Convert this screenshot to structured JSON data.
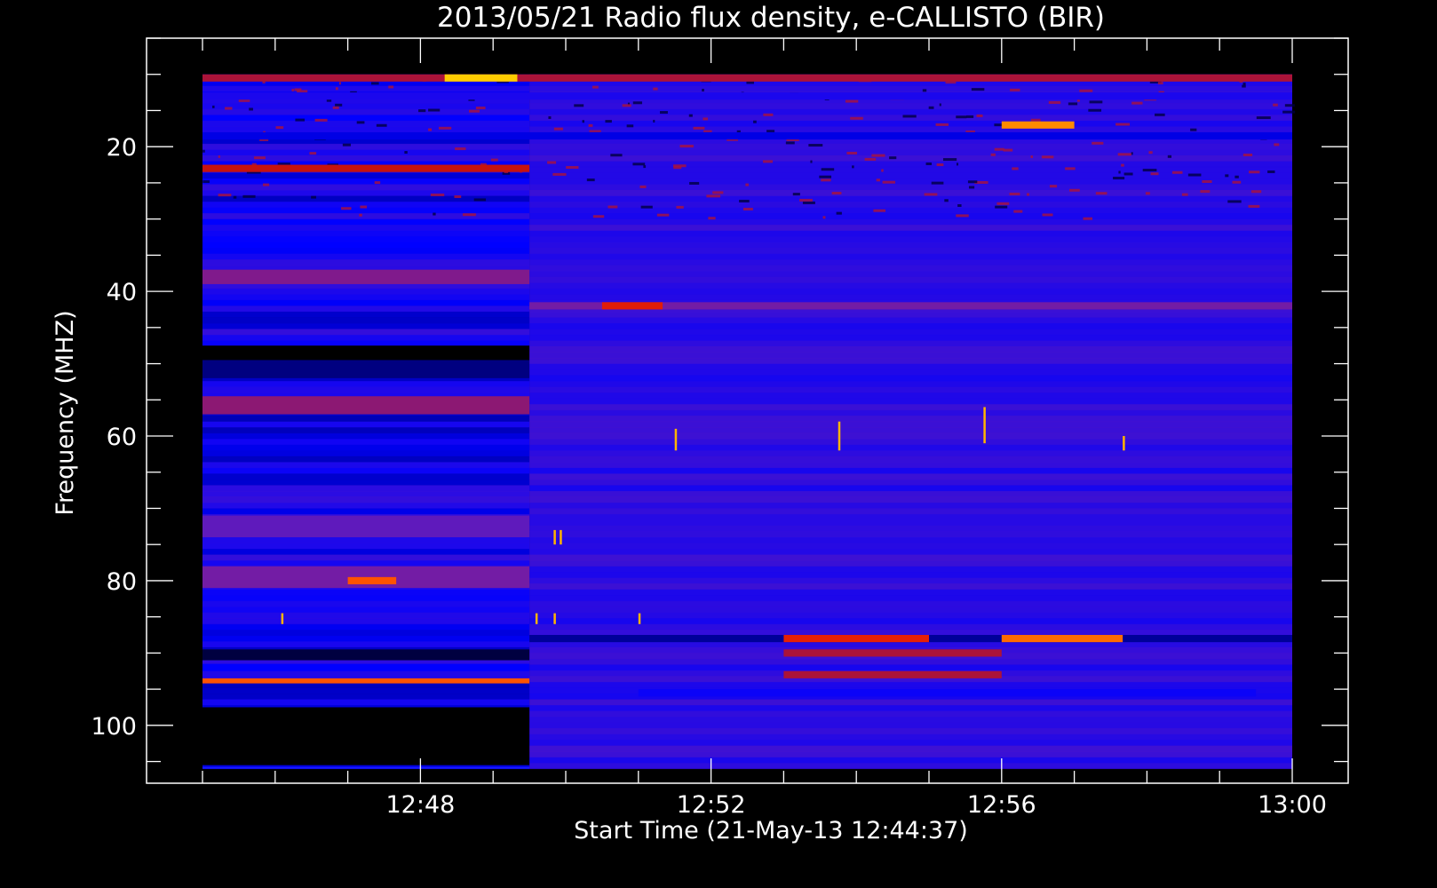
{
  "chart_data": {
    "type": "heatmap",
    "title": "2013/05/21  Radio flux density, e-CALLISTO (BIR)",
    "xlabel": "Start Time (21-May-13 12:44:37)",
    "ylabel": "Frequency (MHZ)",
    "x_axis": {
      "unit": "time (HH:MM)",
      "range": [
        "12:44:37",
        "13:00"
      ],
      "plot_range": [
        "12:45",
        "13:00"
      ],
      "major_ticks": [
        "12:48",
        "12:52",
        "12:56",
        "13:00"
      ],
      "minor_tick_step_min": 1
    },
    "y_axis": {
      "unit": "MHz",
      "inverted": true,
      "range": [
        10,
        106
      ],
      "plot_range": [
        5,
        108
      ],
      "major_ticks": [
        20,
        40,
        60,
        80,
        100
      ],
      "minor_tick_step": 5
    },
    "colormap": [
      "#000000",
      "#0000ff",
      "#6a1db5",
      "#c01010",
      "#ff2a00",
      "#ffcc00"
    ],
    "background_color": "#000000",
    "foreground_color": "#ffffff",
    "grid": false,
    "regime_change_time": "12:49:30",
    "features": [
      {
        "kind": "band",
        "t": [
          "12:45",
          "12:49:30"
        ],
        "f": [
          47.5,
          49.5
        ],
        "level": 0.0
      },
      {
        "kind": "band",
        "t": [
          "12:45",
          "12:49:30"
        ],
        "f": [
          49.5,
          52
        ],
        "level": 0.1
      },
      {
        "kind": "band",
        "t": [
          "12:45",
          "12:49:30"
        ],
        "f": [
          54.5,
          57
        ],
        "level": 0.48
      },
      {
        "kind": "band",
        "t": [
          "12:45",
          "12:49:30"
        ],
        "f": [
          37,
          39
        ],
        "level": 0.45
      },
      {
        "kind": "band",
        "t": [
          "12:45",
          "12:49:30"
        ],
        "f": [
          22.5,
          23.5
        ],
        "level": 0.62
      },
      {
        "kind": "band",
        "t": [
          "12:45",
          "12:49:30"
        ],
        "f": [
          71,
          74
        ],
        "level": 0.38
      },
      {
        "kind": "band",
        "t": [
          "12:45",
          "12:49:30"
        ],
        "f": [
          78,
          81
        ],
        "level": 0.42
      },
      {
        "kind": "band",
        "t": [
          "12:47",
          "12:47:40"
        ],
        "f": [
          79.5,
          80.5
        ],
        "level": 0.85
      },
      {
        "kind": "band",
        "t": [
          "12:45",
          "12:49:30"
        ],
        "f": [
          89.5,
          91
        ],
        "level": 0.05
      },
      {
        "kind": "band",
        "t": [
          "12:45",
          "12:49:30"
        ],
        "f": [
          93.5,
          94.2
        ],
        "level": 0.85
      },
      {
        "kind": "band",
        "t": [
          "12:45",
          "12:49:30"
        ],
        "f": [
          91.5,
          92.5
        ],
        "level": 0.2
      },
      {
        "kind": "band",
        "t": [
          "12:45",
          "12:49:30"
        ],
        "f": [
          97.5,
          105.5
        ],
        "level": 0.0
      },
      {
        "kind": "band",
        "t": [
          "12:45",
          "13:00"
        ],
        "f": [
          10,
          11
        ],
        "level": 0.55
      },
      {
        "kind": "band",
        "t": [
          "12:48:20",
          "12:49:20"
        ],
        "f": [
          10,
          11
        ],
        "level": 1.0
      },
      {
        "kind": "band",
        "t": [
          "12:45",
          "13:00"
        ],
        "f": [
          12.5,
          13.5
        ],
        "level": 0.25
      },
      {
        "kind": "band",
        "t": [
          "12:45",
          "13:00"
        ],
        "f": [
          18,
          19
        ],
        "level": 0.18
      },
      {
        "kind": "band",
        "t": [
          "12:56",
          "12:57"
        ],
        "f": [
          16.5,
          17.5
        ],
        "level": 0.92
      },
      {
        "kind": "band",
        "t": [
          "12:49:30",
          "13:00"
        ],
        "f": [
          41.5,
          42.5
        ],
        "level": 0.42
      },
      {
        "kind": "band",
        "t": [
          "12:50:30",
          "12:51:20"
        ],
        "f": [
          41.5,
          42.5
        ],
        "level": 0.7
      },
      {
        "kind": "band",
        "t": [
          "12:49:30",
          "13:00"
        ],
        "f": [
          87.5,
          88.5
        ],
        "level": 0.12
      },
      {
        "kind": "band",
        "t": [
          "12:53",
          "12:55"
        ],
        "f": [
          87.5,
          88.5
        ],
        "level": 0.72
      },
      {
        "kind": "band",
        "t": [
          "12:56",
          "12:57:40"
        ],
        "f": [
          87.5,
          88.5
        ],
        "level": 0.88
      },
      {
        "kind": "band",
        "t": [
          "12:53",
          "12:56"
        ],
        "f": [
          89.5,
          90.5
        ],
        "level": 0.55
      },
      {
        "kind": "band",
        "t": [
          "12:51:00",
          "12:59:30"
        ],
        "f": [
          95,
          96
        ],
        "level": 0.22
      },
      {
        "kind": "band",
        "t": [
          "12:53",
          "12:56"
        ],
        "f": [
          92.5,
          93.5
        ],
        "level": 0.55
      }
    ],
    "spikes": [
      {
        "t": "12:49:50",
        "f": [
          73,
          75
        ]
      },
      {
        "t": "12:49:55",
        "f": [
          73,
          75
        ]
      },
      {
        "t": "12:49:35",
        "f": [
          84.5,
          86
        ]
      },
      {
        "t": "12:49:50",
        "f": [
          84.5,
          86
        ]
      },
      {
        "t": "12:51:00",
        "f": [
          84.5,
          86
        ]
      },
      {
        "t": "12:46:05",
        "f": [
          84.5,
          86
        ]
      },
      {
        "t": "12:51:30",
        "f": [
          59,
          62
        ]
      },
      {
        "t": "12:53:45",
        "f": [
          58,
          62
        ]
      },
      {
        "t": "12:55:45",
        "f": [
          56,
          61
        ]
      },
      {
        "t": "12:57:40",
        "f": [
          60,
          62
        ]
      }
    ]
  }
}
